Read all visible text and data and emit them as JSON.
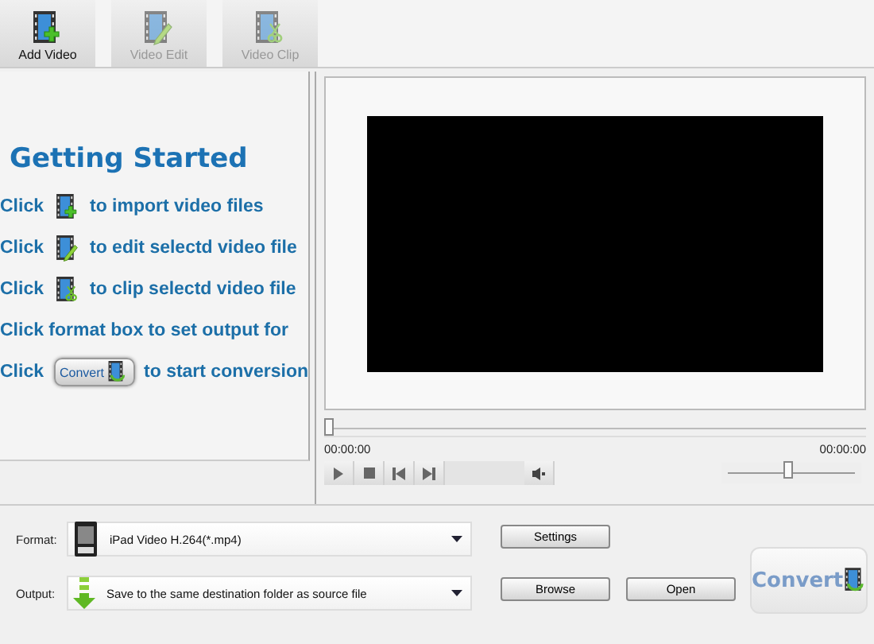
{
  "toolbar": [
    {
      "label": "Add Video",
      "kind": "add",
      "disabled": false
    },
    {
      "label": "Video Edit",
      "kind": "edit",
      "disabled": true
    },
    {
      "label": "Video Clip",
      "kind": "clip",
      "disabled": true
    }
  ],
  "guide": {
    "title": "Getting Started",
    "lines": [
      {
        "kind": "add",
        "before": "Click",
        "after": "to import video files"
      },
      {
        "kind": "edit",
        "before": "Click",
        "after": "to edit selectd video file"
      },
      {
        "kind": "clip",
        "before": "Click",
        "after": "to clip selectd video file"
      },
      {
        "kind": "plain",
        "text": "Click format box to set output for"
      },
      {
        "kind": "convert",
        "before": "Click",
        "button": "Convert",
        "after": "to start conversion"
      }
    ]
  },
  "player": {
    "seek": {
      "level": 0
    },
    "time_start": "00:00:00",
    "time_end": "00:00:00",
    "volume": {
      "level": 0.48
    }
  },
  "settings": {
    "format": {
      "label": "Format:",
      "value": "iPad Video H.264(*.mp4)"
    },
    "output": {
      "label": "Output:",
      "value": "Save to the same destination folder as source file"
    },
    "buttons": [
      "Settings",
      "Browse",
      "Open"
    ],
    "convert": "Convert"
  }
}
